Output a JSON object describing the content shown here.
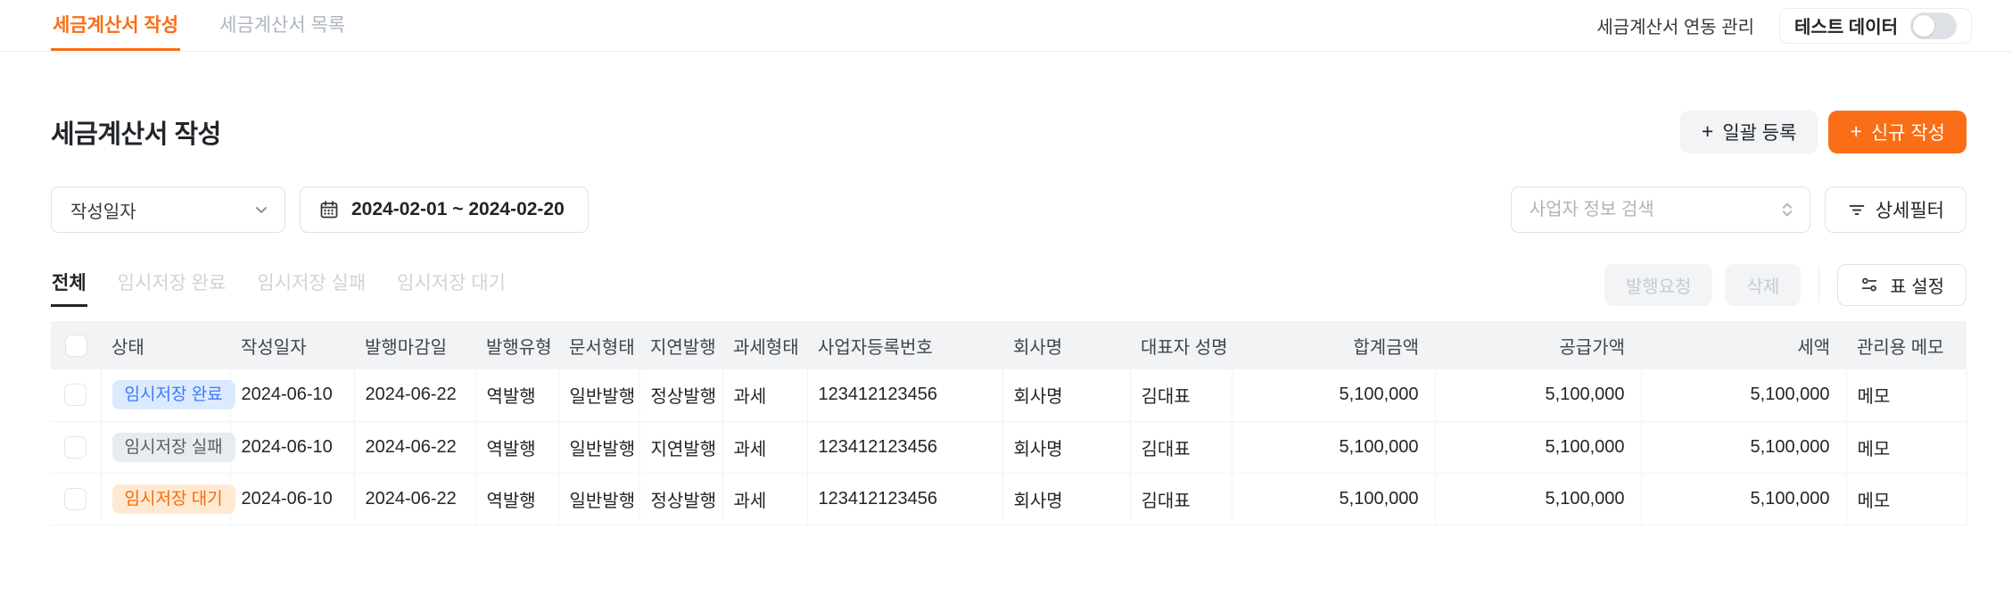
{
  "nav": {
    "tabs": [
      {
        "label": "세금계산서 작성",
        "active": true
      },
      {
        "label": "세금계산서 목록",
        "active": false
      }
    ],
    "link_label": "세금계산서 연동 관리",
    "test_toggle": {
      "label": "테스트 데이터",
      "state": "off"
    }
  },
  "page": {
    "title": "세금계산서 작성",
    "bulk_register_label": "일괄 등록",
    "new_create_label": "신규 작성"
  },
  "filters": {
    "date_type_select": {
      "value": "작성일자"
    },
    "date_range": {
      "value": "2024-02-01 ~ 2024-02-20"
    },
    "business_search": {
      "placeholder": "사업자 정보 검색",
      "value": ""
    },
    "detail_filter_label": "상세필터"
  },
  "status_tabs": [
    {
      "label": "전체",
      "active": true
    },
    {
      "label": "임시저장 완료",
      "active": false
    },
    {
      "label": "임시저장 실패",
      "active": false
    },
    {
      "label": "임시저장 대기",
      "active": false
    }
  ],
  "actions": {
    "request_issue_label": "발행요청",
    "delete_label": "삭제",
    "table_settings_label": "표 설정"
  },
  "table": {
    "columns": [
      "상태",
      "작성일자",
      "발행마감일",
      "발행유형",
      "문서형태",
      "지연발행",
      "과세형태",
      "사업자등록번호",
      "회사명",
      "대표자 성명",
      "합계금액",
      "공급가액",
      "세액",
      "관리용 메모"
    ],
    "rows": [
      {
        "status": "임시저장 완료",
        "status_type": "complete",
        "created": "2024-06-10",
        "deadline": "2024-06-22",
        "issue_type": "역발행",
        "doc_type": "일반발행",
        "delay": "정상발행",
        "tax_type": "과세",
        "biz_no": "123412123456",
        "company": "회사명",
        "ceo": "김대표",
        "total": "5,100,000",
        "supply": "5,100,000",
        "tax": "5,100,000",
        "memo": "메모"
      },
      {
        "status": "임시저장 실패",
        "status_type": "fail",
        "created": "2024-06-10",
        "deadline": "2024-06-22",
        "issue_type": "역발행",
        "doc_type": "일반발행",
        "delay": "지연발행",
        "tax_type": "과세",
        "biz_no": "123412123456",
        "company": "회사명",
        "ceo": "김대표",
        "total": "5,100,000",
        "supply": "5,100,000",
        "tax": "5,100,000",
        "memo": "메모"
      },
      {
        "status": "임시저장 대기",
        "status_type": "wait",
        "created": "2024-06-10",
        "deadline": "2024-06-22",
        "issue_type": "역발행",
        "doc_type": "일반발행",
        "delay": "정상발행",
        "tax_type": "과세",
        "biz_no": "123412123456",
        "company": "회사명",
        "ceo": "김대표",
        "total": "5,100,000",
        "supply": "5,100,000",
        "tax": "5,100,000",
        "memo": "메모"
      }
    ]
  },
  "icons": {
    "plus": "+"
  },
  "colors": {
    "accent_orange": "#F96E16",
    "badge_complete_bg": "#DBEAFE",
    "badge_complete_text": "#3E7BFA",
    "badge_fail_bg": "#E9ECEF",
    "badge_fail_text": "#565E66",
    "badge_wait_bg": "#FFE9D2",
    "badge_wait_text": "#F76B07"
  }
}
